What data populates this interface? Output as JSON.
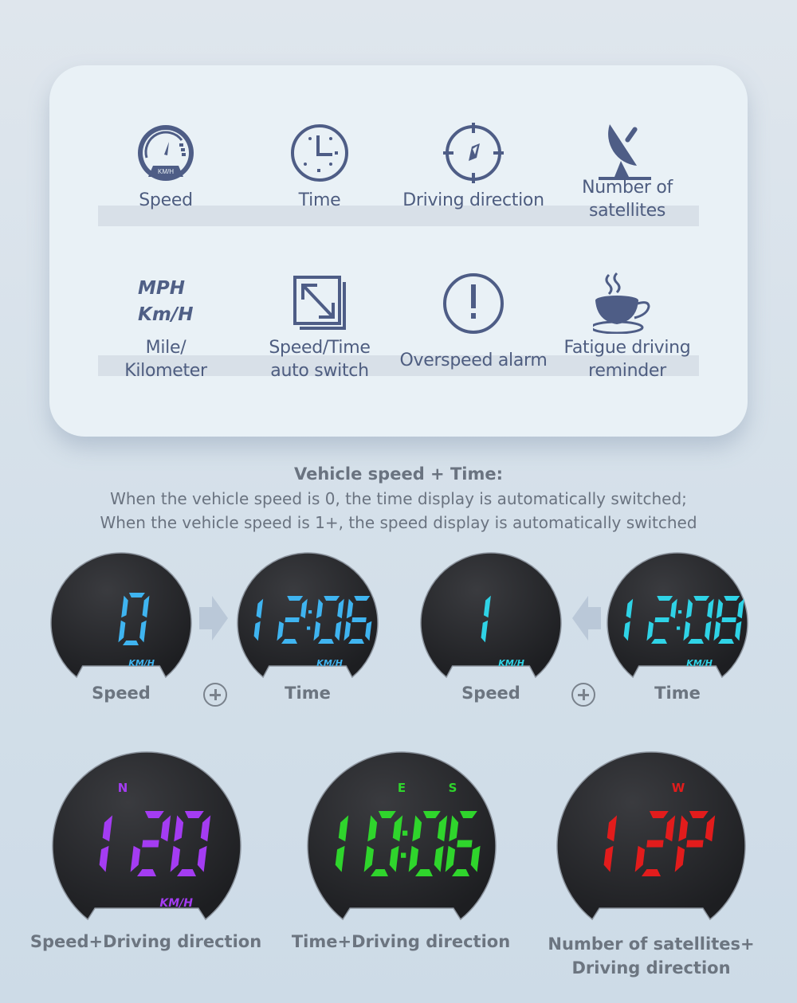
{
  "features": [
    {
      "label": "Speed",
      "icon": "speedometer-icon"
    },
    {
      "label": "Time",
      "icon": "clock-icon"
    },
    {
      "label": "Driving direction",
      "icon": "compass-icon"
    },
    {
      "label_lines": [
        "Number of",
        "satellites"
      ],
      "icon": "satellite-dish-icon"
    },
    {
      "label_lines": [
        "Mile/",
        "Kilometer"
      ],
      "icon": "units-icon",
      "units": [
        "MPH",
        "Km/H"
      ]
    },
    {
      "label_lines": [
        "Speed/Time",
        "auto switch"
      ],
      "icon": "switch-arrows-icon"
    },
    {
      "label": "Overspeed alarm",
      "icon": "alert-icon"
    },
    {
      "label_lines": [
        "Fatigue driving",
        "reminder"
      ],
      "icon": "coffee-cup-icon"
    }
  ],
  "speedometer_unit": "KM/H",
  "section": {
    "title": "Vehicle speed + Time:",
    "line1": "When the vehicle speed is 0, the time display is automatically switched;",
    "line2": "When the vehicle speed is 1+, the speed display is automatically switched"
  },
  "row1": [
    {
      "value": "0",
      "unit": "KM/H",
      "caption": "Speed",
      "color": "#3fb4f0"
    },
    {
      "value": "12:06",
      "unit": "KM/H",
      "caption": "Time",
      "color": "#3fb4f0"
    },
    {
      "value": "1",
      "unit": "KM/H",
      "caption": "Speed",
      "color": "#2fd3e6"
    },
    {
      "value": "12:08",
      "unit": "KM/H",
      "caption": "Time",
      "color": "#2fd3e6"
    }
  ],
  "row2": [
    {
      "value": "120",
      "unit": "KM/H",
      "directions": [
        "N"
      ],
      "caption_lines": [
        "Speed+Driving direction"
      ],
      "color": "#a43cf2"
    },
    {
      "value": "10:06",
      "unit": "",
      "directions": [
        "E",
        "S"
      ],
      "caption_lines": [
        "Time+Driving direction"
      ],
      "color": "#2fd52c"
    },
    {
      "value": "12P",
      "unit": "",
      "directions": [
        "W"
      ],
      "caption_lines": [
        "Number of satellites+",
        "Driving direction"
      ],
      "color": "#e21c1c"
    }
  ]
}
